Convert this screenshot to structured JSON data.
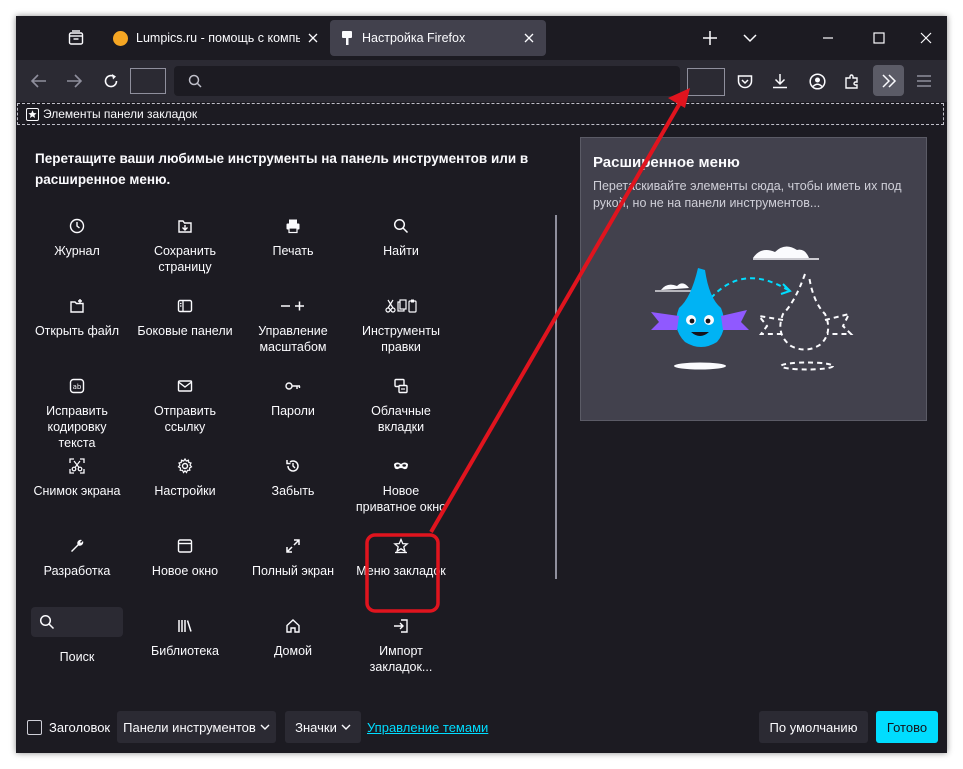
{
  "tabs": [
    {
      "title": "Lumpics.ru - помощь с компь",
      "active": false
    },
    {
      "title": "Настройка Firefox",
      "active": true
    }
  ],
  "bookmarks_toolbar": {
    "label": "Элементы панели закладок"
  },
  "customize": {
    "heading": "Перетащите ваши любимые инструменты на панель инструментов или в расширенное меню.",
    "items": [
      {
        "label": "Журнал",
        "icon": "clock-icon"
      },
      {
        "label": "Сохранить страницу",
        "icon": "save-page-icon"
      },
      {
        "label": "Печать",
        "icon": "print-icon"
      },
      {
        "label": "Найти",
        "icon": "search-icon"
      },
      {
        "label": "Открыть файл",
        "icon": "open-file-icon"
      },
      {
        "label": "Боковые панели",
        "icon": "sidebar-icon"
      },
      {
        "label": "Управление масштабом",
        "icon": "zoom-controls-icon"
      },
      {
        "label": "Инструменты правки",
        "icon": "edit-tools-icon"
      },
      {
        "label": "Исправить кодировку текста",
        "icon": "encoding-icon"
      },
      {
        "label": "Отправить ссылку",
        "icon": "email-icon"
      },
      {
        "label": "Пароли",
        "icon": "key-icon"
      },
      {
        "label": "Облачные вкладки",
        "icon": "synced-tabs-icon"
      },
      {
        "label": "Снимок экрана",
        "icon": "screenshot-icon"
      },
      {
        "label": "Настройки",
        "icon": "gear-icon"
      },
      {
        "label": "Забыть",
        "icon": "forget-icon"
      },
      {
        "label": "Новое приватное окно",
        "icon": "private-mask-icon"
      },
      {
        "label": "Разработка",
        "icon": "wrench-icon"
      },
      {
        "label": "Новое окно",
        "icon": "new-window-icon"
      },
      {
        "label": "Полный экран",
        "icon": "fullscreen-icon"
      },
      {
        "label": "Меню закладок",
        "icon": "bookmark-star-icon"
      },
      {
        "label": "Поиск",
        "icon": "search-icon"
      },
      {
        "label": "Библиотека",
        "icon": "library-icon"
      },
      {
        "label": "Домой",
        "icon": "home-icon"
      },
      {
        "label": "Импорт закладок...",
        "icon": "import-icon"
      }
    ]
  },
  "overflow_panel": {
    "title": "Расширенное меню",
    "description": "Перетаскивайте элементы сюда, чтобы иметь их под рукой, но не на панели инструментов..."
  },
  "footer": {
    "titlebar_label": "Заголовок",
    "toolbars_label": "Панели инструментов",
    "density_label": "Значки",
    "themes_link": "Управление темами",
    "restore_defaults": "По умолчанию",
    "done": "Готово"
  },
  "colors": {
    "accent": "#00ddff",
    "annotation": "#e0141e",
    "background": "#1c1b22",
    "toolbar": "#2b2a33",
    "panel": "#42414d"
  }
}
